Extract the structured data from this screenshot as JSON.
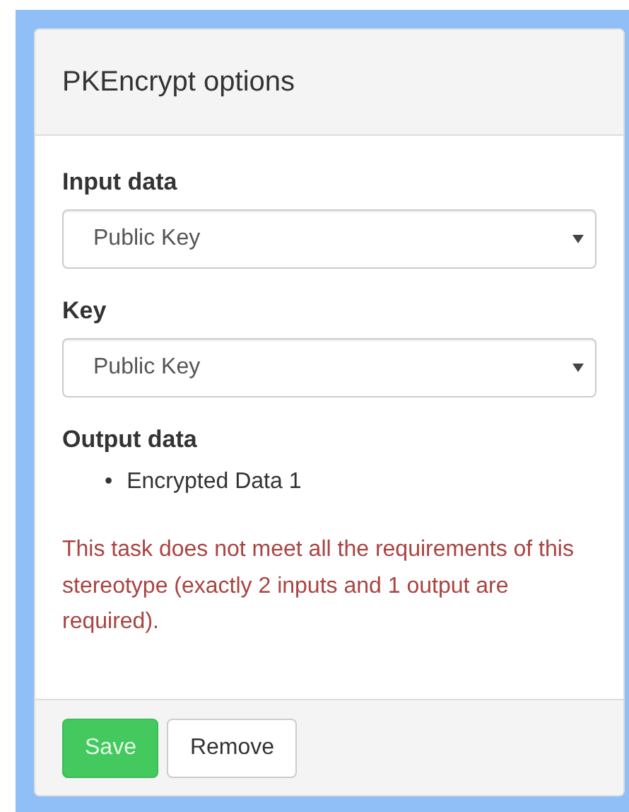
{
  "dialog": {
    "title": "PKEncrypt options"
  },
  "fields": [
    {
      "label": "Input data",
      "value": "Public Key"
    },
    {
      "label": "Key",
      "value": "Public Key"
    }
  ],
  "output": {
    "label": "Output data",
    "items": [
      {
        "bullet": "•",
        "text": "Encrypted Data 1"
      }
    ]
  },
  "error": "This task does not meet all the requirements of this stereotype (exactly 2 inputs and 1 output are required).",
  "buttons": [
    {
      "label": "Save",
      "kind": "primary"
    },
    {
      "label": "Remove",
      "kind": "default"
    }
  ]
}
